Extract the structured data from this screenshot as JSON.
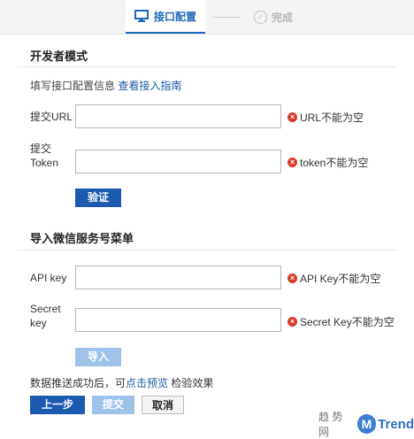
{
  "steps": {
    "active_label": "接口配置",
    "done_label": "完成",
    "done_icon": "check-circle-icon",
    "active_icon": "monitor-icon"
  },
  "developer_mode": {
    "title": "开发者模式",
    "hint_text": "填写接口配置信息 ",
    "guide_link": "查看接入指南",
    "url_label": "提交URL",
    "url_value": "",
    "url_error": "URL不能为空",
    "token_label_line1": "提交",
    "token_label_line2": "Token",
    "token_value": "",
    "token_error": "token不能为空",
    "verify_button": "验证"
  },
  "import_menu": {
    "title": "导入微信服务号菜单",
    "api_key_label": "API key",
    "api_key_value": "",
    "api_key_error": "API Key不能为空",
    "secret_label_line1": "Secret",
    "secret_label_line2": "key",
    "secret_value": "",
    "secret_error": "Secret Key不能为空",
    "import_button": "导入"
  },
  "footer": {
    "note_before": "数据推送成功后，可",
    "note_link": "点击预览",
    "note_after": " 检验效果",
    "prev_button": "上一步",
    "submit_button": "提交",
    "cancel_button": "取消"
  },
  "watermark": {
    "left_text": "趋 势 网",
    "badge": "M",
    "right_text": "Trend"
  },
  "colors": {
    "accent": "#1c5ab0",
    "error": "#d93a2b",
    "disabled": "#9ec2ea"
  }
}
